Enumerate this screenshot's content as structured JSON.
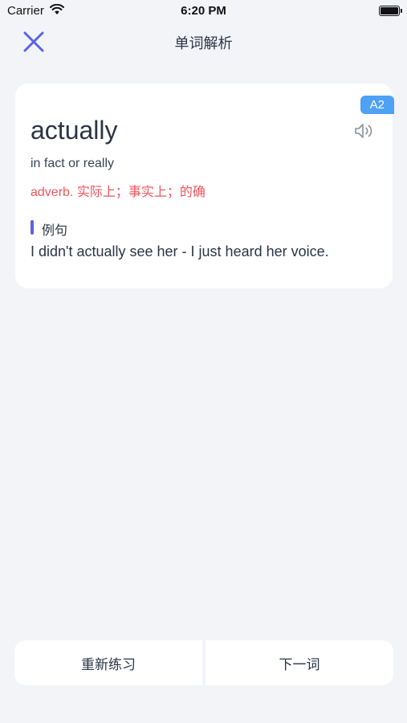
{
  "status_bar": {
    "carrier": "Carrier",
    "time": "6:20 PM"
  },
  "nav": {
    "title": "单词解析",
    "close_icon": "close-icon"
  },
  "card": {
    "level": "A2",
    "word": "actually",
    "definition": "in fact or really",
    "translation": "adverb. 实际上；事实上；的确",
    "example_label": "例句",
    "example_sentence": "I didn't actually see her - I just heard her voice.",
    "speaker_icon": "speaker-icon"
  },
  "actions": {
    "retry_label": "重新练习",
    "next_label": "下一词"
  },
  "colors": {
    "accent": "#5a62e8",
    "badge": "#4ea1f5",
    "translation": "#f0555b",
    "background": "#f2f4f8"
  }
}
